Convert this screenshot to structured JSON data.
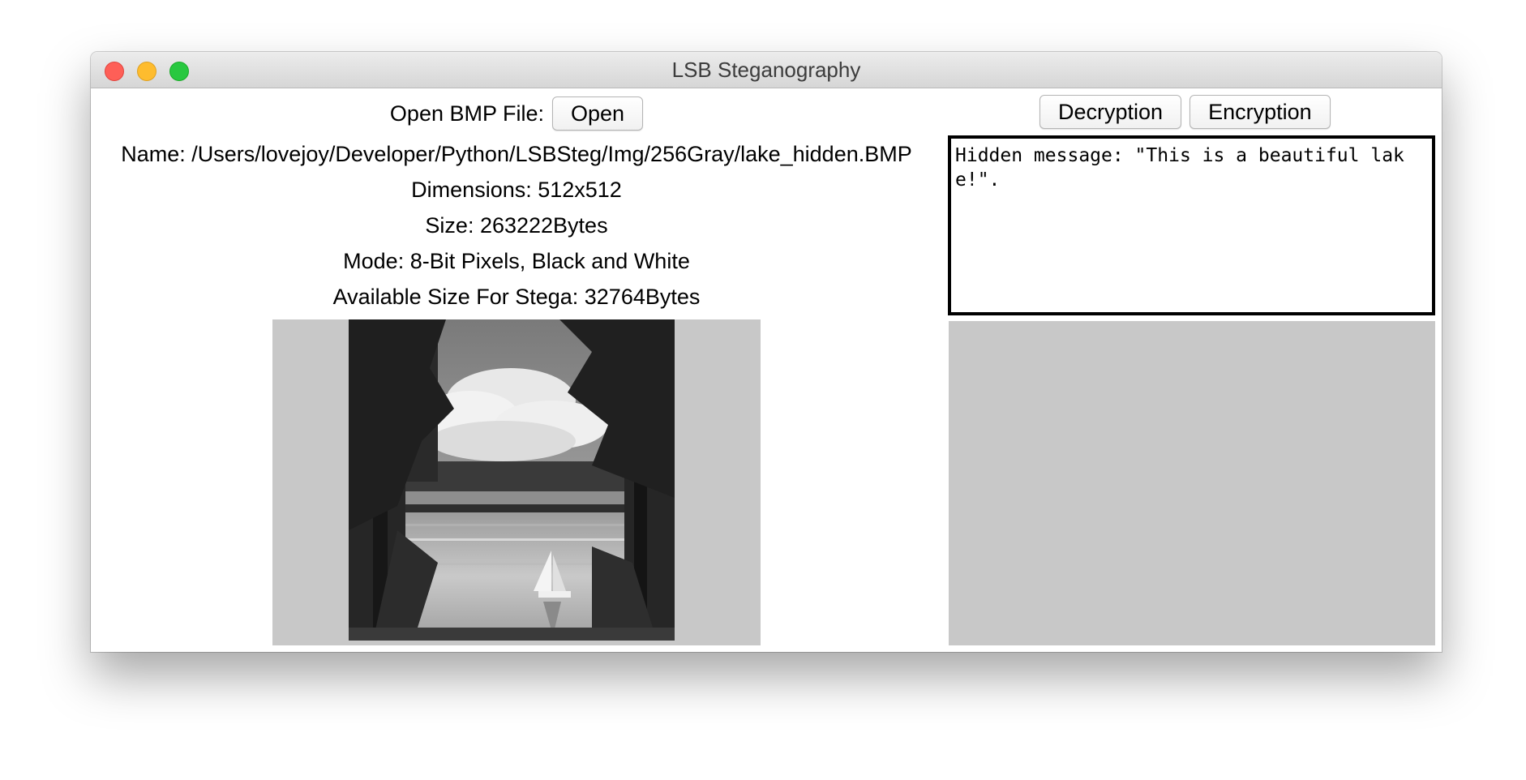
{
  "window": {
    "title": "LSB Steganography"
  },
  "open_section": {
    "label": "Open BMP File:",
    "open_button": "Open"
  },
  "file_info": {
    "name": "Name: /Users/lovejoy/Developer/Python/LSBSteg/Img/256Gray/lake_hidden.BMP",
    "dimensions": "Dimensions: 512x512",
    "size": "Size: 263222Bytes",
    "mode": "Mode: 8-Bit Pixels, Black and White",
    "available": "Available Size For Stega: 32764Bytes"
  },
  "actions": {
    "decryption": "Decryption",
    "encryption": "Encryption"
  },
  "message": {
    "text": "Hidden message: \"This is a beautiful lake!\"."
  },
  "colors": {
    "panel_gray": "#c8c8c8",
    "close": "#fe5f57",
    "minimize": "#febc2e",
    "maximize": "#28c840"
  },
  "icons": {
    "close": "close-icon",
    "minimize": "minimize-icon",
    "maximize": "maximize-icon"
  }
}
